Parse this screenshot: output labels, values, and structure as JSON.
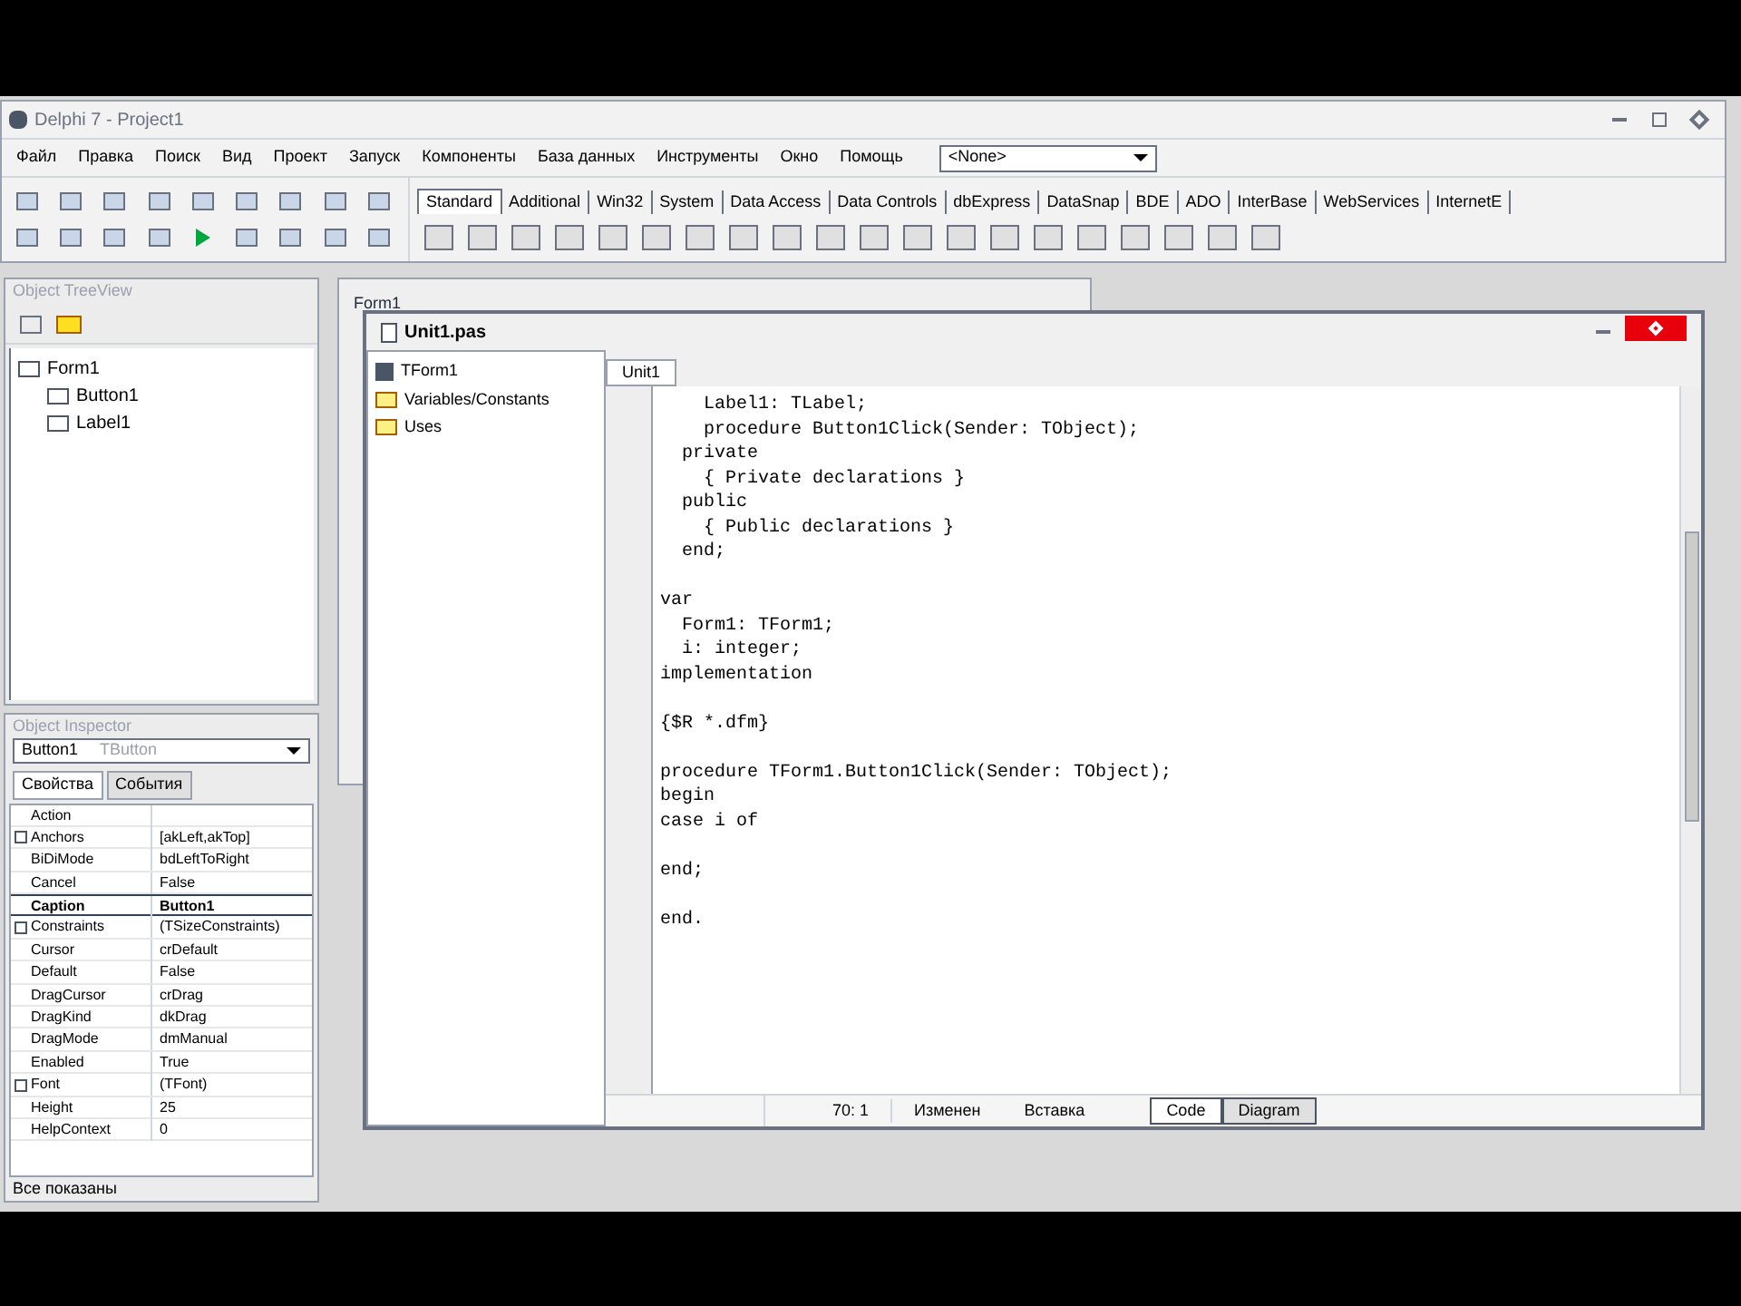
{
  "window": {
    "title": "Delphi 7 - Project1"
  },
  "menu": [
    "Файл",
    "Правка",
    "Поиск",
    "Вид",
    "Проект",
    "Запуск",
    "Компоненты",
    "База данных",
    "Инструменты",
    "Окно",
    "Помощь"
  ],
  "layout_combo": {
    "value": "<None>"
  },
  "palette_tabs": [
    {
      "label": "Standard",
      "selected": true
    },
    {
      "label": "Additional",
      "selected": false
    },
    {
      "label": "Win32",
      "selected": false
    },
    {
      "label": "System",
      "selected": false
    },
    {
      "label": "Data Access",
      "selected": false
    },
    {
      "label": "Data Controls",
      "selected": false
    },
    {
      "label": "dbExpress",
      "selected": false
    },
    {
      "label": "DataSnap",
      "selected": false
    },
    {
      "label": "BDE",
      "selected": false
    },
    {
      "label": "ADO",
      "selected": false
    },
    {
      "label": "InterBase",
      "selected": false
    },
    {
      "label": "WebServices",
      "selected": false
    },
    {
      "label": "InternetE",
      "selected": false
    }
  ],
  "object_tree": {
    "title": "Object TreeView",
    "items": [
      {
        "label": "Form1",
        "children": [
          {
            "label": "Button1"
          },
          {
            "label": "Label1"
          }
        ]
      }
    ]
  },
  "object_inspector": {
    "title": "Object Inspector",
    "object": "Button1",
    "object_type": "TButton",
    "tabs": [
      {
        "label": "Свойства",
        "selected": true
      },
      {
        "label": "События",
        "selected": false
      }
    ],
    "properties": [
      {
        "name": "Action",
        "expandable": false,
        "selected": false
      },
      {
        "name": "Anchors",
        "value": "[akLeft,akTop]",
        "expandable": true,
        "selected": false
      },
      {
        "name": "BiDiMode",
        "value": "bdLeftToRight",
        "expandable": false,
        "selected": false
      },
      {
        "name": "Cancel",
        "value": "False",
        "expandable": false,
        "selected": false
      },
      {
        "name": "Caption",
        "value": "Button1",
        "expandable": false,
        "selected": true
      },
      {
        "name": "Constraints",
        "value": "(TSizeConstraints)",
        "expandable": true,
        "selected": false
      },
      {
        "name": "Cursor",
        "value": "crDefault",
        "expandable": false,
        "selected": false
      },
      {
        "name": "Default",
        "value": "False",
        "expandable": false,
        "selected": false
      },
      {
        "name": "DragCursor",
        "value": "crDrag",
        "expandable": false,
        "selected": false
      },
      {
        "name": "DragKind",
        "value": "dkDrag",
        "expandable": false,
        "selected": false
      },
      {
        "name": "DragMode",
        "value": "dmManual",
        "expandable": false,
        "selected": false
      },
      {
        "name": "Enabled",
        "value": "True",
        "expandable": false,
        "selected": false
      },
      {
        "name": "Font",
        "value": "(TFont)",
        "expandable": true,
        "selected": false
      },
      {
        "name": "Height",
        "value": "25",
        "expandable": false,
        "selected": false
      },
      {
        "name": "HelpContext",
        "value": "0",
        "expandable": false,
        "selected": false
      }
    ],
    "status": "Все показаны"
  },
  "form_window": {
    "title": "Form1"
  },
  "editor": {
    "title": "Unit1.pas",
    "explorer": [
      {
        "label": "TForm1",
        "kind": "class"
      },
      {
        "label": "Variables/Constants",
        "kind": "folder"
      },
      {
        "label": "Uses",
        "kind": "folder"
      }
    ],
    "file_tabs": [
      {
        "label": "Unit1",
        "selected": true
      }
    ],
    "code_blocks": [
      [
        "    Label1: TLabel;",
        "    procedure Button1Click(Sender: TObject);",
        "  private",
        "    { Private declarations }",
        "  public",
        "    { Public declarations }",
        "  end;"
      ],
      [
        "var",
        "  Form1: TForm1;",
        "  i: integer;",
        "implementation"
      ],
      [
        "{$R *.dfm}"
      ],
      [
        "procedure TForm1.Button1Click(Sender: TObject);",
        "begin",
        "case i of"
      ],
      [
        "end;"
      ],
      [
        "end."
      ]
    ],
    "status": {
      "position": "70: 1",
      "modified": "Изменен",
      "mode": "Вставка"
    },
    "view_tabs": [
      {
        "label": "Code",
        "selected": true
      },
      {
        "label": "Diagram",
        "selected": false
      }
    ]
  }
}
